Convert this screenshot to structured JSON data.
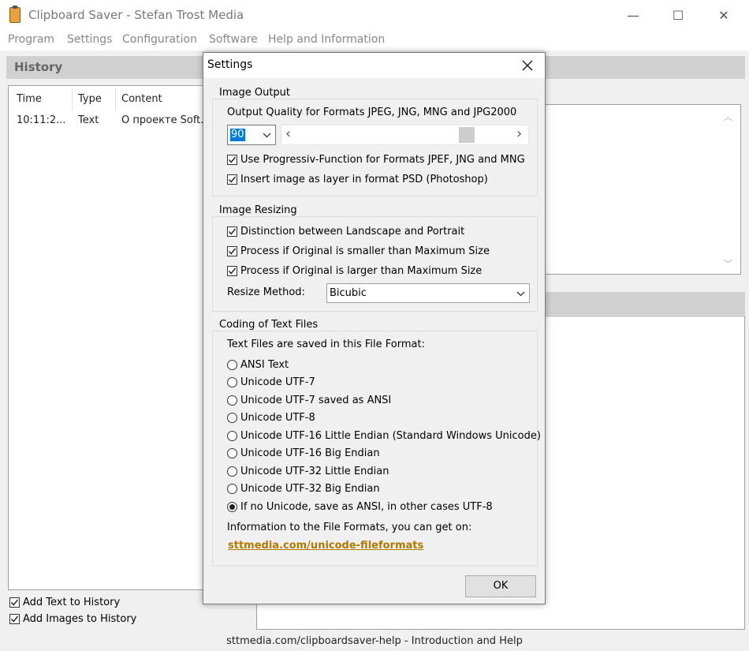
{
  "app": {
    "title": "Clipboard Saver - Stefan Trost Media",
    "window_buttons": {
      "minimize": "—",
      "maximize": "☐",
      "close": "✕"
    }
  },
  "menu": [
    "Program",
    "Settings",
    "Configuration",
    "Software",
    "Help and Information"
  ],
  "history": {
    "title": "History",
    "columns": [
      "Time",
      "Type",
      "Content"
    ],
    "rows": [
      {
        "time": "10:11:2...",
        "type": "Text",
        "content": "О проекте Soft..."
      }
    ],
    "add_text_label": "Add Text to History",
    "add_text_checked": true,
    "add_images_label": "Add Images to History",
    "add_images_checked": true
  },
  "statusbar": {
    "text": "sttmedia.com/clipboardsaver-help - Introduction and Help"
  },
  "dialog": {
    "title": "Settings",
    "image_output": {
      "group_label": "Image Output",
      "quality_label": "Output Quality for Formats JPEG, JNG, MNG and JPG2000",
      "quality_value": "90",
      "scroll_left": "‹",
      "scroll_right": "›",
      "quality_fraction": 0.82,
      "progressive_label": "Use Progressiv-Function for Formats JPEF, JNG and MNG",
      "progressive_checked": true,
      "psd_label": "Insert image as layer in format PSD (Photoshop)",
      "psd_checked": true
    },
    "image_resizing": {
      "group_label": "Image Resizing",
      "distinction_label": "Distinction between Landscape and Portrait",
      "distinction_checked": true,
      "smaller_label": "Process if Original is smaller than Maximum Size",
      "smaller_checked": true,
      "larger_label": "Process if Original is larger than Maximum Size",
      "larger_checked": true,
      "method_label": "Resize Method:",
      "method_value": "Bicubic"
    },
    "coding": {
      "group_label": "Coding of Text Files",
      "format_label": "Text Files are saved in this File Format:",
      "options": [
        "ANSI Text",
        "Unicode UTF-7",
        "Unicode UTF-7 saved as ANSI",
        "Unicode UTF-8",
        "Unicode UTF-16 Little Endian (Standard Windows Unicode)",
        "Unicode UTF-16 Big Endian",
        "Unicode UTF-32 Little Endian",
        "Unicode UTF-32 Big Endian",
        "If no Unicode, save as ANSI, in other cases UTF-8"
      ],
      "selected_index": 8,
      "info_label": "Information to the File Formats, you can get on:",
      "link": "sttmedia.com/unicode-fileformats"
    },
    "ok_label": "OK",
    "colors": {
      "link": "#b07a00",
      "selection": "#0078d7"
    }
  }
}
